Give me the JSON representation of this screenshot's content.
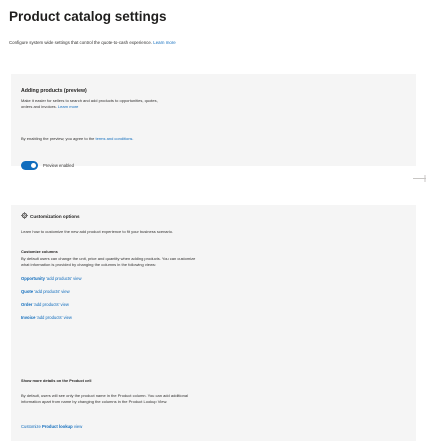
{
  "page": {
    "title": "Product catalog settings",
    "description": "Configure system wide settings that control the quote-to-cash experience.",
    "learn_more": "Learn more"
  },
  "adding_products": {
    "title": "Adding products (preview)",
    "description_line1": "Make it easier for sellers to search and add products to opportunities, quotes,",
    "description_line2": "orders and invoices.",
    "learn_more": "Learn more",
    "agree_prefix": "By enabling the preview, you agree to the",
    "terms_link": "terms and conditions.",
    "toggle_on": true,
    "toggle_label": "Preview enabled"
  },
  "customization": {
    "title": "Customization options",
    "learn_link": "Learn how to customize the new add product experience to fit your business scenario.",
    "columns_title": "Customize columns",
    "columns_desc_line1": "By default users can change the unit, price and quantity when adding products. You can customize",
    "columns_desc_line2": "what information is provided by changing the columns in the following views:",
    "views": [
      {
        "name": "Opportunity",
        "rest": " 'add products' view"
      },
      {
        "name": "Quote",
        "rest": " 'add products' view"
      },
      {
        "name": "Order",
        "rest": " 'add products' view"
      },
      {
        "name": "Invoice",
        "rest": " 'add products' view"
      }
    ],
    "details_title": "Show more details on the Product cell",
    "details_desc_line1": "By default, users will see only the product name in the Product column. You can add additional",
    "details_desc_line2": "information apart from name by changing the columns in the Product Lookup View.",
    "lookup_prefix": "Customize",
    "lookup_bold": "Product lookup",
    "lookup_suffix": " view"
  },
  "colors": {
    "accent": "#0f6cbd",
    "card_background": "#f5f5f5"
  }
}
